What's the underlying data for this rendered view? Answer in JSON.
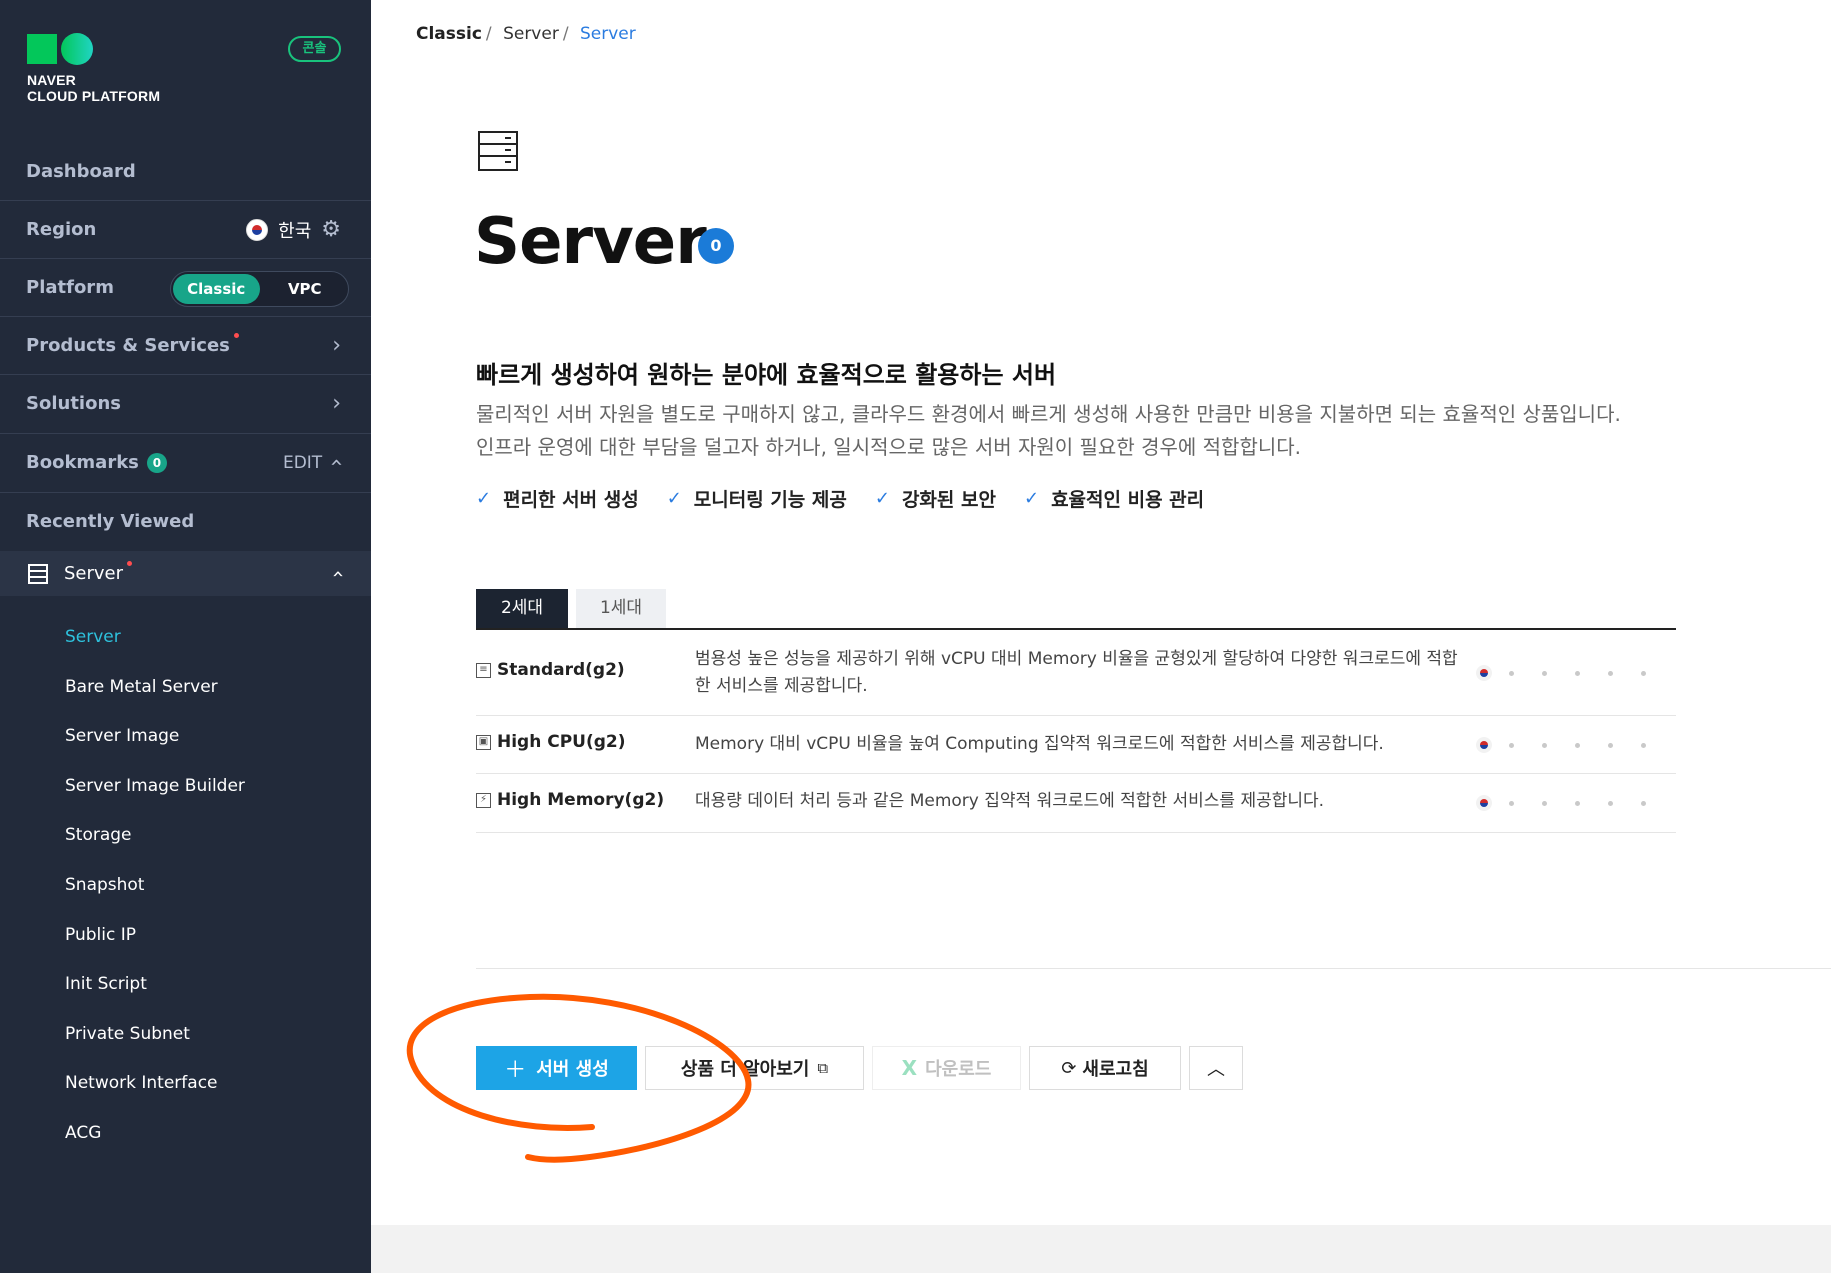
{
  "brand": {
    "logo_line1": "NAVER",
    "logo_line2": "CLOUD PLATFORM",
    "console_label": "콘솔",
    "accent_color": "#18a589"
  },
  "sidebar": {
    "dashboard": "Dashboard",
    "region_label": "Region",
    "region_value": "한국",
    "platform_label": "Platform",
    "platform_options": [
      "Classic",
      "VPC"
    ],
    "platform_selected": "Classic",
    "products_services": "Products & Services",
    "solutions": "Solutions",
    "bookmarks_label": "Bookmarks",
    "bookmarks_count": "0",
    "bookmarks_edit": "EDIT",
    "recently_viewed": "Recently Viewed",
    "current_service": "Server",
    "sub_items": [
      "Server",
      "Bare Metal Server",
      "Server Image",
      "Server Image Builder",
      "Storage",
      "Snapshot",
      "Public IP",
      "Init Script",
      "Private Subnet",
      "Network Interface",
      "ACG"
    ],
    "active_sub_item": "Server"
  },
  "breadcrumb": {
    "items": [
      "Classic",
      "Server",
      "Server"
    ]
  },
  "page": {
    "title": "Server",
    "count": "0",
    "headline": "빠르게 생성하여 원하는 분야에 효율적으로 활용하는 서버",
    "description_line1": "물리적인 서버 자원을 별도로 구매하지 않고, 클라우드 환경에서 빠르게 생성해 사용한 만큼만 비용을 지불하면 되는 효율적인 상품입니다.",
    "description_line2": "인프라 운영에 대한 부담을 덜고자 하거나, 일시적으로 많은 서버 자원이 필요한 경우에 적합합니다.",
    "features": [
      "편리한 서버 생성",
      "모니터링 기능 제공",
      "강화된 보안",
      "효율적인 비용 관리"
    ]
  },
  "tabs": {
    "items": [
      "2세대",
      "1세대"
    ],
    "selected": "2세대"
  },
  "products": [
    {
      "name": "Standard(g2)",
      "icon": "server-rack-icon",
      "description": "범용성 높은 성능을 제공하기 위해 vCPU 대비 Memory 비율을 균형있게 할당하여 다양한 워크로드에 적합한 서비스를 제공합니다."
    },
    {
      "name": "High CPU(g2)",
      "icon": "cpu-icon",
      "description": "Memory 대비 vCPU 비율을 높여 Computing 집약적 워크로드에 적합한 서비스를 제공합니다."
    },
    {
      "name": "High Memory(g2)",
      "icon": "memory-icon",
      "description": "대용량 데이터 처리 등과 같은 Memory 집약적 워크로드에 적합한 서비스를 제공합니다."
    }
  ],
  "actions": {
    "create_server": "서버 생성",
    "learn_more": "상품 더 알아보기",
    "download": "다운로드",
    "refresh": "새로고침"
  },
  "colors": {
    "sidebar_bg": "#222a3a",
    "primary_button": "#1da4e6",
    "link_blue": "#2b7ce0",
    "annotation_orange": "#ff5a00"
  }
}
